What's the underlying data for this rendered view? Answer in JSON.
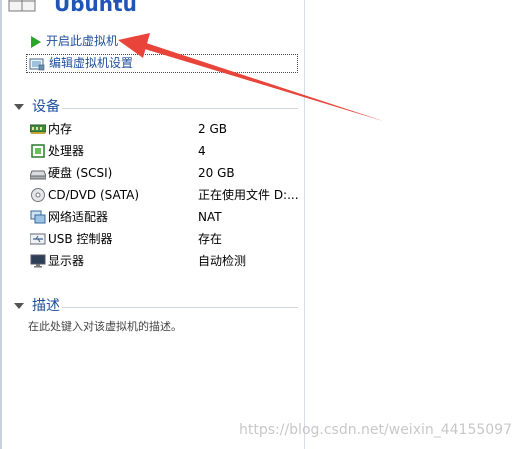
{
  "vm": {
    "name": "Ubuntu"
  },
  "actions": {
    "power_on_label": "开启此虚拟机",
    "edit_settings_label": "编辑虚拟机设置"
  },
  "devices": {
    "header": "设备",
    "items": [
      {
        "name": "内存",
        "value": "2 GB",
        "icon": "memory-icon"
      },
      {
        "name": "处理器",
        "value": "4",
        "icon": "processor-icon"
      },
      {
        "name": "硬盘 (SCSI)",
        "value": "20 GB",
        "icon": "harddisk-icon"
      },
      {
        "name": "CD/DVD (SATA)",
        "value": "正在使用文件 D:...",
        "icon": "cd-dvd-icon"
      },
      {
        "name": "网络适配器",
        "value": "NAT",
        "icon": "network-adapter-icon"
      },
      {
        "name": "USB 控制器",
        "value": "存在",
        "icon": "usb-icon"
      },
      {
        "name": "显示器",
        "value": "自动检测",
        "icon": "display-icon"
      }
    ]
  },
  "description": {
    "header": "描述",
    "placeholder": "在此处键入对该虚拟机的描述。"
  },
  "watermark": "https://blog.csdn.net/weixin_44155097",
  "colors": {
    "link": "#1f4e9a",
    "title": "#1f55b4",
    "annotation_arrow": "#e8443a"
  }
}
